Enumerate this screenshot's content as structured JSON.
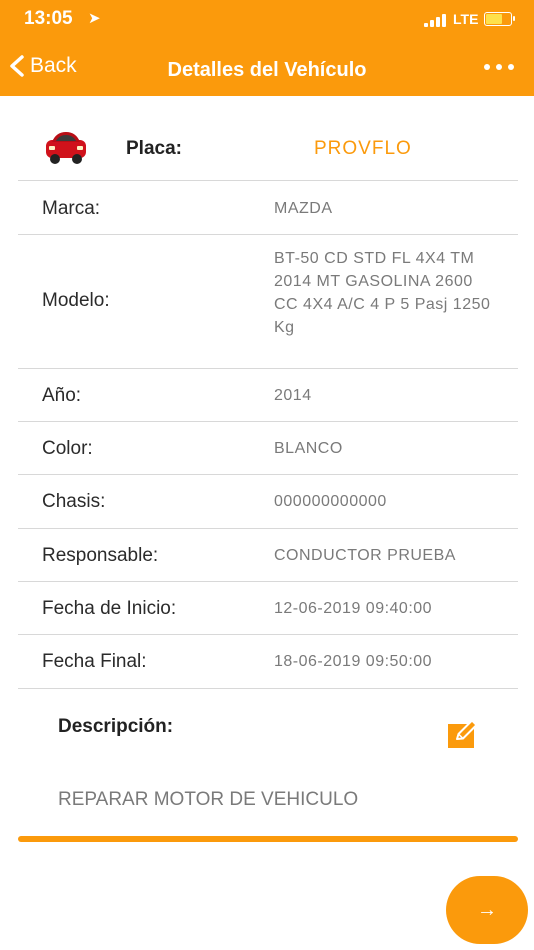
{
  "status": {
    "time": "13:05",
    "network": "LTE"
  },
  "nav": {
    "back_label": "Back",
    "title": "Detalles del Vehículo"
  },
  "plate": {
    "label": "Placa:",
    "value": "PROVFLO"
  },
  "details": [
    {
      "label": "Marca:",
      "value": "MAZDA"
    },
    {
      "label": "Modelo:",
      "value": "BT-50 CD STD FL 4X4 TM 2014 MT GASOLINA 2600 CC 4X4 A/C 4 P 5 Pasj 1250 Kg"
    },
    {
      "label": "Año:",
      "value": "2014"
    },
    {
      "label": "Color:",
      "value": "BLANCO"
    },
    {
      "label": "Chasis:",
      "value": "000000000000"
    },
    {
      "label": "Responsable:",
      "value": "CONDUCTOR PRUEBA"
    },
    {
      "label": "Fecha de Inicio:",
      "value": "12-06-2019 09:40:00"
    },
    {
      "label": "Fecha Final:",
      "value": "18-06-2019 09:50:00"
    }
  ],
  "description": {
    "label": "Descripción:",
    "value": "REPARAR MOTOR DE VEHICULO"
  },
  "icons": {
    "car": "car-icon",
    "edit": "edit-icon",
    "next": "arrow-right-icon",
    "more": "more-dots-icon",
    "back": "chevron-left-icon"
  },
  "colors": {
    "accent": "#fb9a0c",
    "car": "#d0121b"
  }
}
